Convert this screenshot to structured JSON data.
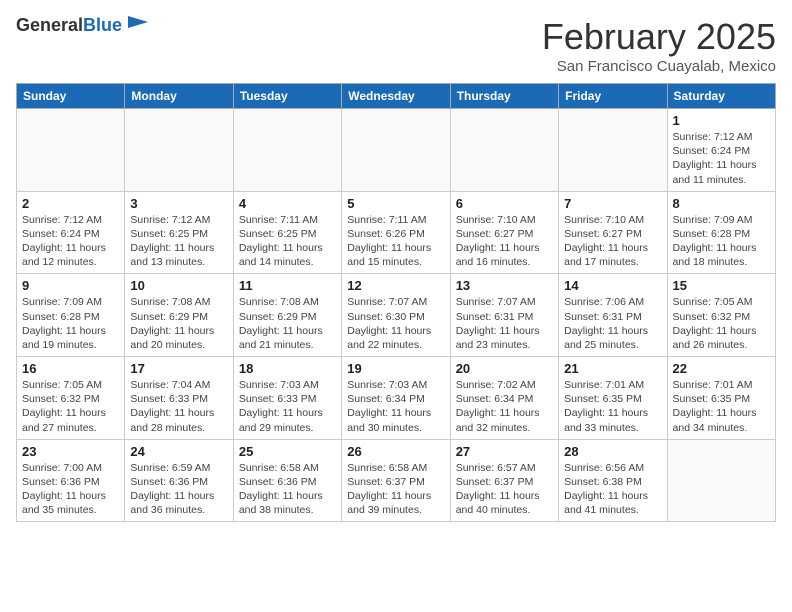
{
  "header": {
    "logo_general": "General",
    "logo_blue": "Blue",
    "month_title": "February 2025",
    "location": "San Francisco Cuayalab, Mexico"
  },
  "weekdays": [
    "Sunday",
    "Monday",
    "Tuesday",
    "Wednesday",
    "Thursday",
    "Friday",
    "Saturday"
  ],
  "weeks": [
    [
      {
        "day": "",
        "info": ""
      },
      {
        "day": "",
        "info": ""
      },
      {
        "day": "",
        "info": ""
      },
      {
        "day": "",
        "info": ""
      },
      {
        "day": "",
        "info": ""
      },
      {
        "day": "",
        "info": ""
      },
      {
        "day": "1",
        "info": "Sunrise: 7:12 AM\nSunset: 6:24 PM\nDaylight: 11 hours\nand 11 minutes."
      }
    ],
    [
      {
        "day": "2",
        "info": "Sunrise: 7:12 AM\nSunset: 6:24 PM\nDaylight: 11 hours\nand 12 minutes."
      },
      {
        "day": "3",
        "info": "Sunrise: 7:12 AM\nSunset: 6:25 PM\nDaylight: 11 hours\nand 13 minutes."
      },
      {
        "day": "4",
        "info": "Sunrise: 7:11 AM\nSunset: 6:25 PM\nDaylight: 11 hours\nand 14 minutes."
      },
      {
        "day": "5",
        "info": "Sunrise: 7:11 AM\nSunset: 6:26 PM\nDaylight: 11 hours\nand 15 minutes."
      },
      {
        "day": "6",
        "info": "Sunrise: 7:10 AM\nSunset: 6:27 PM\nDaylight: 11 hours\nand 16 minutes."
      },
      {
        "day": "7",
        "info": "Sunrise: 7:10 AM\nSunset: 6:27 PM\nDaylight: 11 hours\nand 17 minutes."
      },
      {
        "day": "8",
        "info": "Sunrise: 7:09 AM\nSunset: 6:28 PM\nDaylight: 11 hours\nand 18 minutes."
      }
    ],
    [
      {
        "day": "9",
        "info": "Sunrise: 7:09 AM\nSunset: 6:28 PM\nDaylight: 11 hours\nand 19 minutes."
      },
      {
        "day": "10",
        "info": "Sunrise: 7:08 AM\nSunset: 6:29 PM\nDaylight: 11 hours\nand 20 minutes."
      },
      {
        "day": "11",
        "info": "Sunrise: 7:08 AM\nSunset: 6:29 PM\nDaylight: 11 hours\nand 21 minutes."
      },
      {
        "day": "12",
        "info": "Sunrise: 7:07 AM\nSunset: 6:30 PM\nDaylight: 11 hours\nand 22 minutes."
      },
      {
        "day": "13",
        "info": "Sunrise: 7:07 AM\nSunset: 6:31 PM\nDaylight: 11 hours\nand 23 minutes."
      },
      {
        "day": "14",
        "info": "Sunrise: 7:06 AM\nSunset: 6:31 PM\nDaylight: 11 hours\nand 25 minutes."
      },
      {
        "day": "15",
        "info": "Sunrise: 7:05 AM\nSunset: 6:32 PM\nDaylight: 11 hours\nand 26 minutes."
      }
    ],
    [
      {
        "day": "16",
        "info": "Sunrise: 7:05 AM\nSunset: 6:32 PM\nDaylight: 11 hours\nand 27 minutes."
      },
      {
        "day": "17",
        "info": "Sunrise: 7:04 AM\nSunset: 6:33 PM\nDaylight: 11 hours\nand 28 minutes."
      },
      {
        "day": "18",
        "info": "Sunrise: 7:03 AM\nSunset: 6:33 PM\nDaylight: 11 hours\nand 29 minutes."
      },
      {
        "day": "19",
        "info": "Sunrise: 7:03 AM\nSunset: 6:34 PM\nDaylight: 11 hours\nand 30 minutes."
      },
      {
        "day": "20",
        "info": "Sunrise: 7:02 AM\nSunset: 6:34 PM\nDaylight: 11 hours\nand 32 minutes."
      },
      {
        "day": "21",
        "info": "Sunrise: 7:01 AM\nSunset: 6:35 PM\nDaylight: 11 hours\nand 33 minutes."
      },
      {
        "day": "22",
        "info": "Sunrise: 7:01 AM\nSunset: 6:35 PM\nDaylight: 11 hours\nand 34 minutes."
      }
    ],
    [
      {
        "day": "23",
        "info": "Sunrise: 7:00 AM\nSunset: 6:36 PM\nDaylight: 11 hours\nand 35 minutes."
      },
      {
        "day": "24",
        "info": "Sunrise: 6:59 AM\nSunset: 6:36 PM\nDaylight: 11 hours\nand 36 minutes."
      },
      {
        "day": "25",
        "info": "Sunrise: 6:58 AM\nSunset: 6:36 PM\nDaylight: 11 hours\nand 38 minutes."
      },
      {
        "day": "26",
        "info": "Sunrise: 6:58 AM\nSunset: 6:37 PM\nDaylight: 11 hours\nand 39 minutes."
      },
      {
        "day": "27",
        "info": "Sunrise: 6:57 AM\nSunset: 6:37 PM\nDaylight: 11 hours\nand 40 minutes."
      },
      {
        "day": "28",
        "info": "Sunrise: 6:56 AM\nSunset: 6:38 PM\nDaylight: 11 hours\nand 41 minutes."
      },
      {
        "day": "",
        "info": ""
      }
    ]
  ]
}
